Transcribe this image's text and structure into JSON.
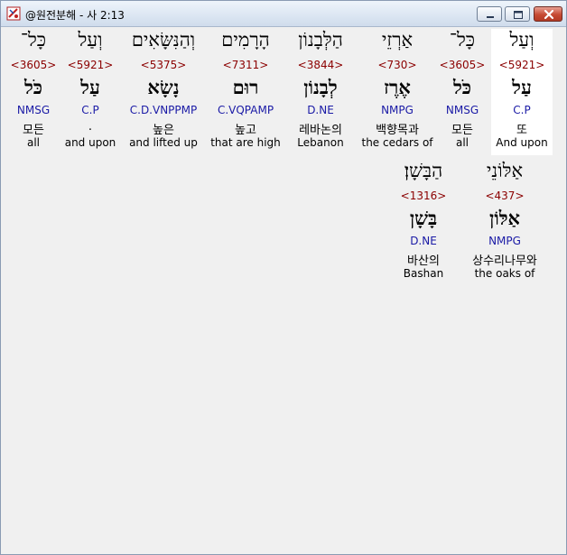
{
  "window": {
    "title": "@원전분해 - 사 2:13"
  },
  "words": [
    {
      "hebrew": "וְעַל",
      "strong": "<5921>",
      "lemma": "עַל",
      "morph": "C.P",
      "korean": "또",
      "english": "And upon"
    },
    {
      "hebrew": "כָּל־",
      "strong": "<3605>",
      "lemma": "כֹּל",
      "morph": "NMSG",
      "korean": "모든",
      "english": "all"
    },
    {
      "hebrew": "אַרְזֵי",
      "strong": "<730>",
      "lemma": "אֶרֶז",
      "morph": "NMPG",
      "korean": "백향목과",
      "english": "the cedars of"
    },
    {
      "hebrew": "הַלְּבָנוֹן",
      "strong": "<3844>",
      "lemma": "לְבָנוֹן",
      "morph": "D.NE",
      "korean": "레바논의",
      "english": "Lebanon"
    },
    {
      "hebrew": "הָרָמִים",
      "strong": "<7311>",
      "lemma": "רוּם",
      "morph": "C.VQPAMP",
      "korean": "높고",
      "english": "that are high"
    },
    {
      "hebrew": "וְהַנִּשָּׂאִים",
      "strong": "<5375>",
      "lemma": "נָשָׂא",
      "morph": "C.D.VNPPMP",
      "korean": "높은",
      "english": "and lifted up"
    },
    {
      "hebrew": "וְעַל",
      "strong": "<5921>",
      "lemma": "עַל",
      "morph": "C.P",
      "korean": ".",
      "english": "and upon"
    },
    {
      "hebrew": "כָּל־",
      "strong": "<3605>",
      "lemma": "כֹּל",
      "morph": "NMSG",
      "korean": "모든",
      "english": "all"
    },
    {
      "hebrew": "אַלּוֹנֵי",
      "strong": "<437>",
      "lemma": "אַלּוֹן",
      "morph": "NMPG",
      "korean": "상수리나무와",
      "english": "the oaks of"
    },
    {
      "hebrew": "הַבָּשָׁן׃",
      "strong": "<1316>",
      "lemma": "בָּשָׁן",
      "morph": "D.NE",
      "korean": "바산의",
      "english": "Bashan"
    }
  ]
}
